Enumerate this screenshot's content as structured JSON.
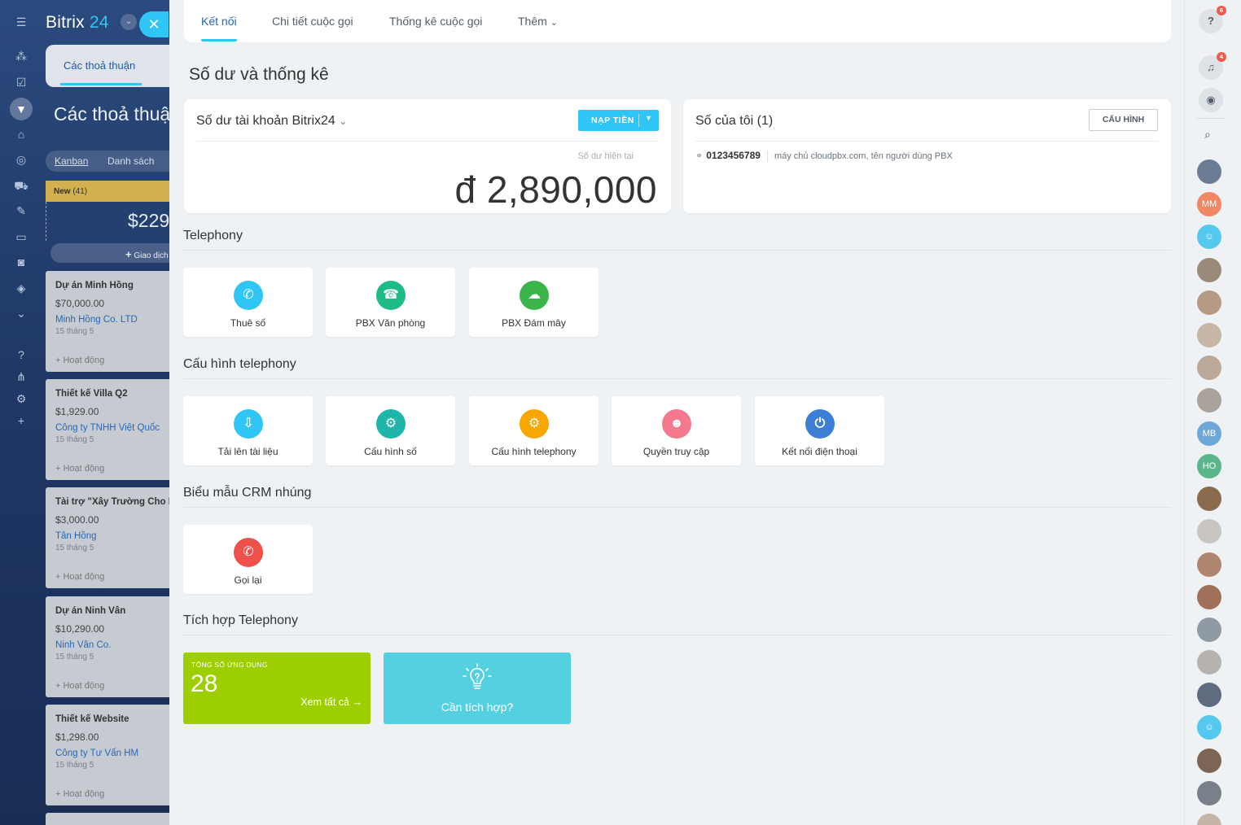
{
  "app": {
    "logo_main": "Bitrix",
    "logo_accent": "24",
    "close_icon": "close-icon"
  },
  "background": {
    "panel_tab": "Các thoả thuận",
    "page_title": "Các thoả thuận",
    "views": [
      "Kanban",
      "Danh sách"
    ],
    "stage": {
      "name": "New",
      "count": "(41)",
      "sum": "$229"
    },
    "add_deal": "Giao dịch",
    "cards": [
      {
        "title": "Dự án Minh Hồng",
        "price": "$70,000.00",
        "company": "Minh Hồng Co. LTD",
        "date": "15 tháng 5",
        "activity": "+ Hoạt động"
      },
      {
        "title": "Thiết kế Villa Q2",
        "price": "$1,929.00",
        "company": "Công ty TNHH Việt Quốc",
        "date": "15 tháng 5",
        "activity": "+ Hoạt động"
      },
      {
        "title": "Tài trợ \"Xây Trường Cho E",
        "price": "$3,000.00",
        "company": "Tân Hồng",
        "date": "15 tháng 5",
        "activity": "+ Hoạt động"
      },
      {
        "title": "Dự án Ninh Vân",
        "price": "$10,290.00",
        "company": "Ninh Vân Co.",
        "date": "15 tháng 5",
        "activity": "+ Hoạt động"
      },
      {
        "title": "Thiết kế Website",
        "price": "$1,298.00",
        "company": "Công ty Tư Vấn HM",
        "date": "15 tháng 5",
        "activity": "+ Hoạt động"
      }
    ]
  },
  "tabs": [
    "Kết nối",
    "Chi tiết cuộc gọi",
    "Thống kê cuộc gọi",
    "Thêm"
  ],
  "page_title": "Số dư và thống kê",
  "balance": {
    "title": "Số dư tài khoản Bitrix24",
    "topup_label": "NẠP TIỀN",
    "current_label": "Số dư hiện tại",
    "amount": "đ 2,890,000"
  },
  "numbers": {
    "title": "Số của tôi (1)",
    "config_label": "CẤU HÌNH",
    "phone": "0123456789",
    "description": "máy chủ cloudpbx.com, tên người dùng PBX"
  },
  "sections": {
    "telephony": "Telephony",
    "config": "Cấu hình telephony",
    "crm_forms": "Biểu mẫu CRM nhúng",
    "integration": "Tích hợp Telephony"
  },
  "telephony_tiles": [
    {
      "label": "Thuê số",
      "icon": "phone-rent-icon",
      "color": "#2fc6f6"
    },
    {
      "label": "PBX Văn phòng",
      "icon": "office-pbx-icon",
      "color": "#1fbb86"
    },
    {
      "label": "PBX Đám mây",
      "icon": "cloud-pbx-icon",
      "color": "#3bb44a"
    }
  ],
  "config_tiles": [
    {
      "label": "Tải lên tài liệu",
      "icon": "document-upload-icon",
      "color": "#2fc6f6"
    },
    {
      "label": "Cấu hình số",
      "icon": "number-config-icon",
      "color": "#1fb5a8"
    },
    {
      "label": "Cấu hình telephony",
      "icon": "telephony-config-icon",
      "color": "#f7a700"
    },
    {
      "label": "Quyền truy cập",
      "icon": "access-permission-icon",
      "color": "#f4788e"
    },
    {
      "label": "Kết nối điện thoại",
      "icon": "phone-connect-icon",
      "color": "#3e7fd6"
    }
  ],
  "crm_tiles": [
    {
      "label": "Gọi lại",
      "icon": "callback-icon",
      "color": "#f0504a"
    }
  ],
  "integration": {
    "apps_caption": "TỔNG SỐ ỨNG DỤNG",
    "apps_count": "28",
    "view_all": "Xem tất cả →",
    "need_label": "Cần tích hợp?"
  },
  "rightbar": {
    "help_badge": "6",
    "notify_badge": "4",
    "avatars": [
      "",
      "MM",
      "",
      "",
      "",
      "",
      "",
      "",
      "MB",
      "HO",
      "",
      "",
      "",
      "",
      "",
      "",
      "",
      "",
      "",
      "",
      ""
    ]
  }
}
